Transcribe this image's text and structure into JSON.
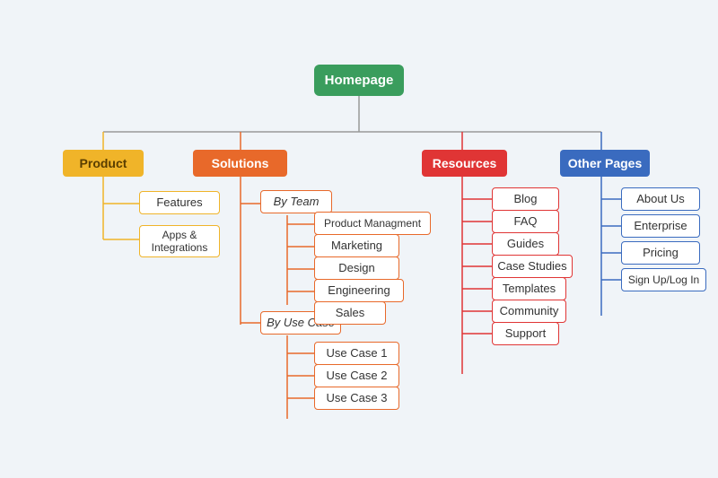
{
  "nodes": {
    "homepage": {
      "label": "Homepage"
    },
    "product": {
      "label": "Product"
    },
    "solutions": {
      "label": "Solutions"
    },
    "resources": {
      "label": "Resources"
    },
    "otherpages": {
      "label": "Other Pages"
    },
    "features": {
      "label": "Features"
    },
    "apps": {
      "label": "Apps &\nIntegrations"
    },
    "byTeam": {
      "label": "By Team"
    },
    "byUseCase": {
      "label": "By Use Case"
    },
    "productMgmt": {
      "label": "Product Managment"
    },
    "marketing": {
      "label": "Marketing"
    },
    "design": {
      "label": "Design"
    },
    "engineering": {
      "label": "Engineering"
    },
    "sales": {
      "label": "Sales"
    },
    "useCase1": {
      "label": "Use Case 1"
    },
    "useCase2": {
      "label": "Use Case 2"
    },
    "useCase3": {
      "label": "Use Case 3"
    },
    "blog": {
      "label": "Blog"
    },
    "faq": {
      "label": "FAQ"
    },
    "guides": {
      "label": "Guides"
    },
    "caseStudies": {
      "label": "Case Studies"
    },
    "templates": {
      "label": "Templates"
    },
    "community": {
      "label": "Community"
    },
    "support": {
      "label": "Support"
    },
    "aboutUs": {
      "label": "About Us"
    },
    "enterprise": {
      "label": "Enterprise"
    },
    "pricing": {
      "label": "Pricing"
    },
    "signUp": {
      "label": "Sign Up/Log In"
    }
  }
}
